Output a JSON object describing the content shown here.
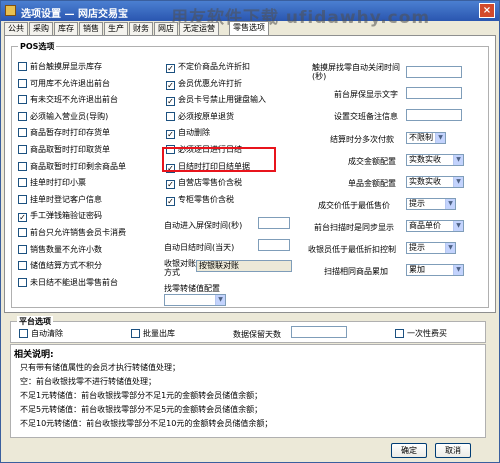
{
  "window": {
    "title": "选项设置 — 网店交易宝",
    "close_glyph": "×"
  },
  "watermark": "用友软件下载 ufidawhy.com",
  "tabs": [
    "公共",
    "采购",
    "库存",
    "销售",
    "生产",
    "财务",
    "网店",
    "无定运营",
    "零售选项"
  ],
  "pos_group": {
    "title": "POS选项",
    "col1": [
      {
        "label": "前台触摸屏显示库存",
        "checked": false
      },
      {
        "label": "可用库不允许退出前台",
        "checked": false
      },
      {
        "label": "有未交班不允许退出前台",
        "checked": false
      },
      {
        "label": "必须输入营业员(导购)",
        "checked": false
      },
      {
        "label": "商品暂存时打印存货单",
        "checked": false
      },
      {
        "label": "商品取暂时打印取货单",
        "checked": false
      },
      {
        "label": "商品取暂时打印剩余商品单",
        "checked": false
      },
      {
        "label": "挂单时打印小票",
        "checked": false
      },
      {
        "label": "挂单时登记客户信息",
        "checked": false
      },
      {
        "label": "手工弹钱箱验证密码",
        "checked": true
      },
      {
        "label": "前台只允许销售会员卡消费",
        "checked": false
      },
      {
        "label": "销售数量不允许小数",
        "checked": false
      },
      {
        "label": "储值结算方式不积分",
        "checked": false
      },
      {
        "label": "未日结不能退出零售前台",
        "checked": false
      }
    ],
    "col2": [
      {
        "label": "不定价商品允许折扣",
        "checked": true
      },
      {
        "label": "会员优惠允许打折",
        "checked": true
      },
      {
        "label": "会员卡号禁止用键盘输入",
        "checked": true
      },
      {
        "label": "必须按原单退货",
        "checked": false
      },
      {
        "label": "自动删除",
        "checked": true
      },
      {
        "label": "必须逐日进行日结",
        "checked": false
      },
      {
        "label": "日结时打印日结单据",
        "checked": true
      },
      {
        "label": "自营店零售价含税",
        "checked": true
      },
      {
        "label": "专柜零售价含税",
        "checked": true
      }
    ],
    "auto_lock_label": "自动进入屏保时间(秒)",
    "auto_lock_value": "",
    "auto_daily_label": "自动日结时间(当天)",
    "auto_daily_value": "",
    "recv_method_label": "收银对账方式",
    "recv_method_value": "按银联对账",
    "change_label": "找零转储值配置",
    "change_value": "",
    "col3": {
      "touch_timeout_label": "触摸屏找零自动关闭时间(秒)",
      "touch_timeout_value": "",
      "screen_text_label": "前台屏保显示文字",
      "screen_text_value": "",
      "receipt_label": "设置交班备注信息",
      "receipt_value": "",
      "payment_label": "结算时分多次付款",
      "payment_value": "不限制",
      "cost_label": "成交金额配置",
      "cost_value": "实数实收",
      "price_label": "单品金额配置",
      "price_value": "实数实收",
      "low_price_label": "成交价低于最低售价",
      "low_price_value": "提示",
      "scan_label": "前台扫描时是同步显示",
      "scan_value": "商品单价",
      "discount_label": "收银员低于最低折扣控制",
      "discount_value": "提示",
      "barcode_label": "扫描相同商品累加",
      "barcode_value": "累加"
    }
  },
  "platform_group": {
    "title": "平台选项",
    "auto_clear": {
      "label": "自动清除",
      "checked": false
    },
    "batch_out": {
      "label": "批量出库",
      "checked": false
    },
    "days_label": "数据保留天数",
    "days_value": "",
    "one_time": {
      "label": "一次性费买",
      "checked": false
    }
  },
  "notes": {
    "title": "相关说明:",
    "lines": [
      "只有带有储值属性的会员才执行转储值处理；",
      "空：前台收银找零不进行转储值处理；",
      "不足1元转储值：前台收银找零部分不足1元的金额转会员储值余额；",
      "不足5元转储值：前台收银找零部分不足5元的金额转会员储值余额；",
      "不足10元转储值：前台收银找零部分不足10元的金额转会员储值余额；"
    ]
  },
  "buttons": {
    "ok": "确定",
    "cancel": "取消"
  },
  "colors": {
    "highlight": "#e8141c",
    "titlebar": "#2a56b0"
  }
}
